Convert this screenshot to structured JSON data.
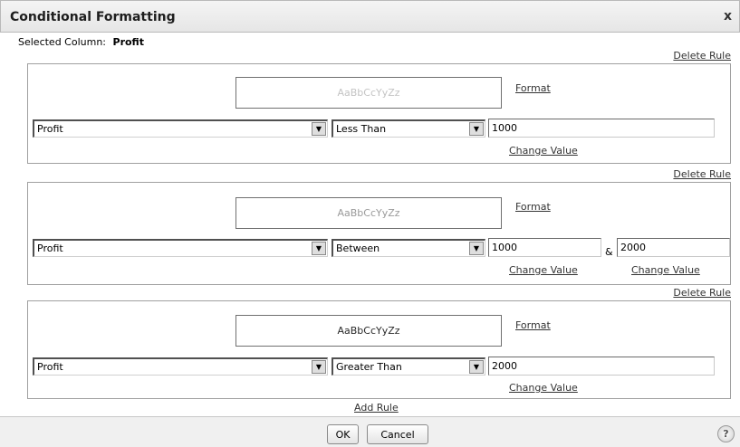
{
  "dialog": {
    "title": "Conditional Formatting",
    "close_glyph": "x",
    "selected_column_label": "Selected Column:",
    "selected_column_value": "Profit"
  },
  "rules": [
    {
      "delete_label": "Delete Rule",
      "preview_text": "AaBbCcYyZz",
      "format_label": "Format",
      "column": "Profit",
      "operator": "Less Than",
      "value1": "1000",
      "change_value_label": "Change Value"
    },
    {
      "delete_label": "Delete Rule",
      "preview_text": "AaBbCcYyZz",
      "format_label": "Format",
      "column": "Profit",
      "operator": "Between",
      "value1": "1000",
      "and_label": "&",
      "value2": "2000",
      "change_value_label": "Change Value",
      "change_value2_label": "Change Value"
    },
    {
      "delete_label": "Delete Rule",
      "preview_text": "AaBbCcYyZz",
      "format_label": "Format",
      "column": "Profit",
      "operator": "Greater Than",
      "value1": "2000",
      "change_value_label": "Change Value"
    }
  ],
  "add_rule_label": "Add Rule",
  "buttons": {
    "ok": "OK",
    "cancel": "Cancel",
    "help": "?"
  },
  "colors": {
    "preview_text_1": "#c4c4c4",
    "preview_text_2": "#9a9a9a",
    "preview_text_3": "#2a2a2a"
  }
}
